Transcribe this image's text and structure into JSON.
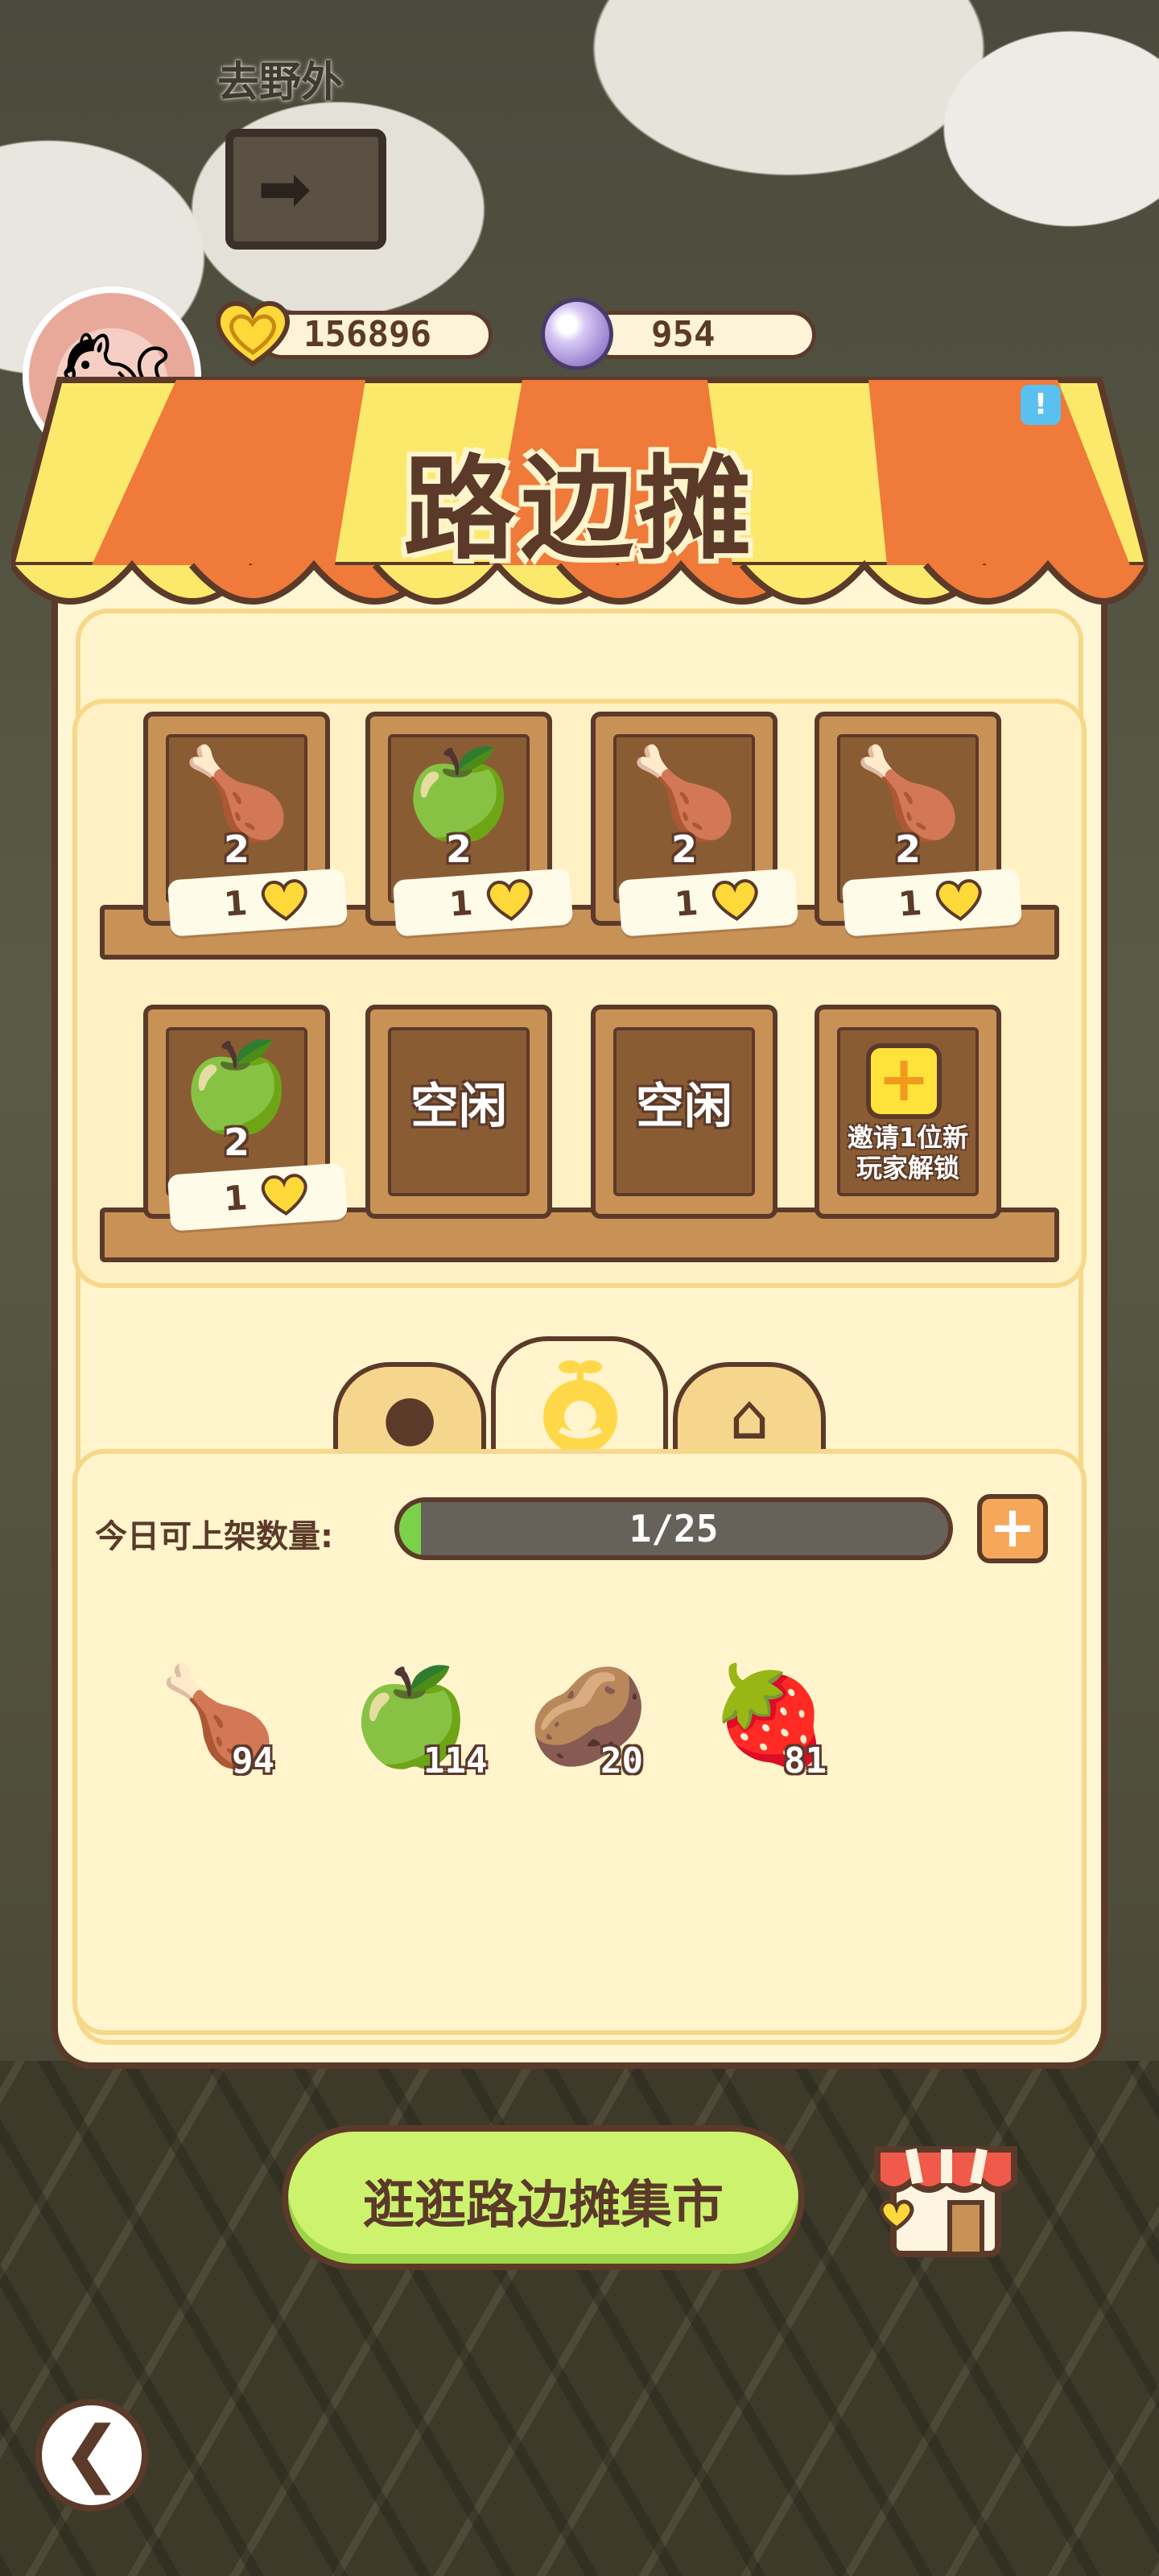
{
  "header": {
    "go_wild_label": "去野外",
    "hearts": "156896",
    "gems": "954",
    "info_badge": "!"
  },
  "stall": {
    "title": "路边摊",
    "slots_row1": [
      {
        "icon": "🍗",
        "count": "2",
        "price": "1"
      },
      {
        "icon": "🍏",
        "count": "2",
        "price": "1"
      },
      {
        "icon": "🍗",
        "count": "2",
        "price": "1"
      },
      {
        "icon": "🍗",
        "count": "2",
        "price": "1"
      }
    ],
    "slots_row2": [
      {
        "icon": "🍏",
        "count": "2",
        "price": "1"
      },
      {
        "status": "空闲"
      },
      {
        "status": "空闲"
      },
      {
        "invite": "邀请1位新\n玩家解锁"
      }
    ]
  },
  "tabs": [
    {
      "name": "produce",
      "icon": "tomato-icon"
    },
    {
      "name": "cooked",
      "icon": "sprout-bowl-icon",
      "active": true
    },
    {
      "name": "storage",
      "icon": "house-icon"
    }
  ],
  "inventory": {
    "quota_label": "今日可上架数量:",
    "quota_text": "1/25",
    "quota_used": 1,
    "quota_max": 25,
    "items": [
      {
        "icon": "🍗",
        "count": "94"
      },
      {
        "icon": "🍏",
        "count": "114"
      },
      {
        "icon": "🥔",
        "count": "20"
      },
      {
        "icon": "🍓",
        "count": "81"
      }
    ]
  },
  "market_button": "逛逛路边摊集市",
  "colors": {
    "outline": "#5b3a2a",
    "panel": "#fff6d3",
    "button_green": "#cdf36e",
    "awning_orange": "#ef7a3a",
    "awning_yellow": "#fbe96b"
  }
}
